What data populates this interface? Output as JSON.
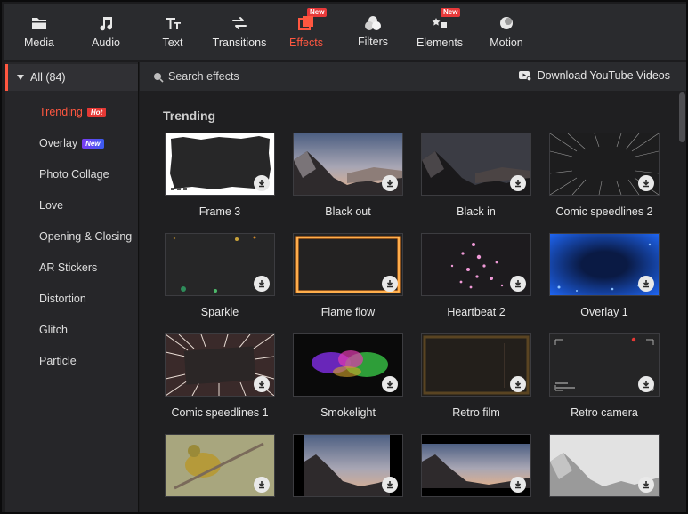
{
  "toolbar": {
    "items": [
      {
        "label": "Media",
        "icon": "folder-icon"
      },
      {
        "label": "Audio",
        "icon": "music-note-icon"
      },
      {
        "label": "Text",
        "icon": "text-icon"
      },
      {
        "label": "Transitions",
        "icon": "swap-arrows-icon"
      },
      {
        "label": "Effects",
        "icon": "effects-icon",
        "badge": "New",
        "active": true
      },
      {
        "label": "Filters",
        "icon": "filters-icon"
      },
      {
        "label": "Elements",
        "icon": "elements-icon",
        "badge": "New"
      },
      {
        "label": "Motion",
        "icon": "motion-icon"
      }
    ],
    "accent": "#ff5740"
  },
  "sidebar": {
    "all_label": "All (84)",
    "items": [
      {
        "label": "Trending",
        "tag": "Hot",
        "active": true
      },
      {
        "label": "Overlay",
        "tag": "New"
      },
      {
        "label": "Photo Collage"
      },
      {
        "label": "Love"
      },
      {
        "label": "Opening & Closing"
      },
      {
        "label": "AR Stickers"
      },
      {
        "label": "Distortion"
      },
      {
        "label": "Glitch"
      },
      {
        "label": "Particle"
      }
    ]
  },
  "search": {
    "placeholder": "Search effects",
    "icon": "search-icon"
  },
  "youtube": {
    "label": "Download YouTube Videos",
    "icon": "youtube-icon"
  },
  "section": {
    "title": "Trending"
  },
  "effects": [
    {
      "name": "Frame 3"
    },
    {
      "name": "Black out"
    },
    {
      "name": "Black in"
    },
    {
      "name": "Comic speedlines 2"
    },
    {
      "name": "Sparkle"
    },
    {
      "name": "Flame flow"
    },
    {
      "name": "Heartbeat 2"
    },
    {
      "name": "Overlay 1"
    },
    {
      "name": "Comic speedlines 1"
    },
    {
      "name": "Smokelight"
    },
    {
      "name": "Retro film"
    },
    {
      "name": "Retro camera"
    },
    {
      "name": ""
    },
    {
      "name": ""
    },
    {
      "name": ""
    },
    {
      "name": ""
    }
  ]
}
